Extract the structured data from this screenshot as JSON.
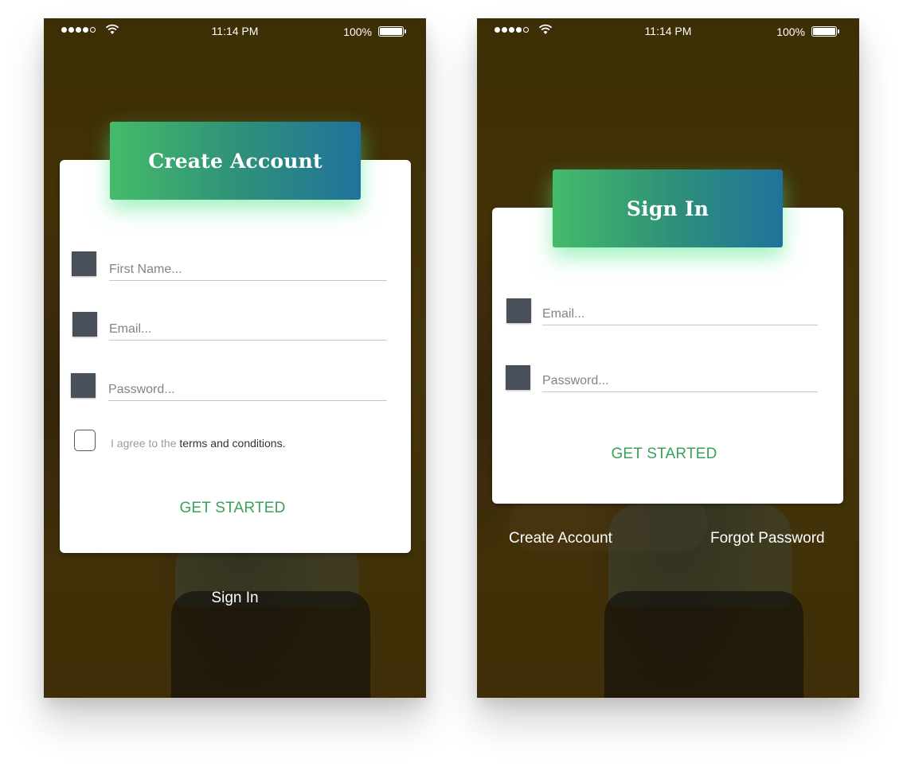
{
  "status_bar": {
    "time": "11:14 PM",
    "battery": "100%",
    "signal_dots_filled": 4,
    "signal_dots_total": 5
  },
  "colors": {
    "background": "#45340a",
    "banner_gradient": [
      "#44bb6a",
      "#20729c"
    ],
    "cta": "#3aa15a",
    "field_icon": "#4a5059"
  },
  "create_account_screen": {
    "title": "Create Account",
    "fields": {
      "first_name_placeholder": "First Name...",
      "email_placeholder": "Email...",
      "password_placeholder": "Password..."
    },
    "terms_prefix": "I agree to the ",
    "terms_link": "terms and conditions.",
    "submit_label": "GET STARTED",
    "footer_link": "Sign In"
  },
  "sign_in_screen": {
    "title": "Sign In",
    "fields": {
      "email_placeholder": "Email...",
      "password_placeholder": "Password..."
    },
    "submit_label": "GET STARTED",
    "footer_left": "Create Account",
    "footer_right": "Forgot Password"
  }
}
